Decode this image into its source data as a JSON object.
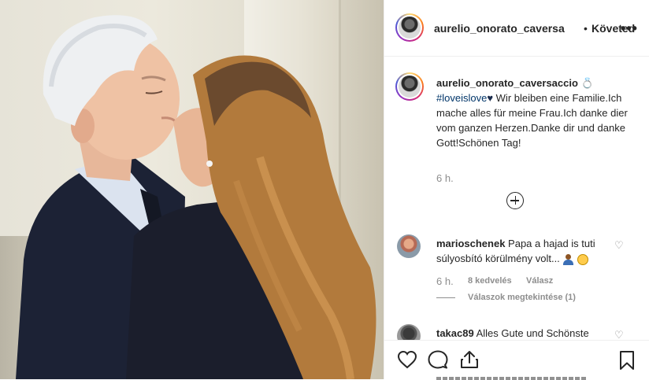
{
  "post": {
    "header": {
      "username": "aurelio_onorato_caversa",
      "separator": "•",
      "follow_label": "Követed",
      "more_label": "•••"
    },
    "caption": {
      "username": "aurelio_onorato_caversaccio",
      "ring_emoji": "💍",
      "hashtag": "#loveislove",
      "heart": "♥",
      "text": " Wir bleiben eine Familie.Ich mache alles für meine Frau.Ich danke dier vom ganzen Herzen.Danke dir und danke Gott!Schönen Tag!",
      "time": "6 h."
    },
    "comments": [
      {
        "username": "marioschenek",
        "text": " Papa a hajad is tuti súlyosbító körülmény volt...",
        "time": "6 h.",
        "likes": "8 kedvelés",
        "reply_label": "Válasz",
        "view_replies": "Válaszok megtekintése (1)",
        "like_icon": "♡"
      },
      {
        "username": "takac89",
        "text": " Alles Gute und Schönste",
        "like_icon": "♡"
      }
    ],
    "icons": {
      "like": "heart-icon",
      "comment": "comment-icon",
      "share": "share-icon",
      "save": "bookmark-icon",
      "load_more": "plus-circle-icon"
    },
    "colors": {
      "text": "#262626",
      "muted": "#8e8e8e",
      "hashtag": "#003569",
      "border": "#efefef"
    }
  }
}
